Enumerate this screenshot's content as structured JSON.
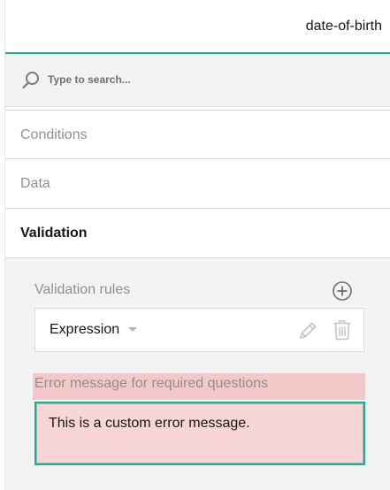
{
  "header": {
    "title": "date-of-birth"
  },
  "search": {
    "placeholder": "Type to search..."
  },
  "sections": [
    {
      "label": "Conditions",
      "active": false
    },
    {
      "label": "Data",
      "active": false
    },
    {
      "label": "Validation",
      "active": true
    }
  ],
  "validation": {
    "rules_label": "Validation rules",
    "rules": [
      {
        "type": "Expression"
      }
    ],
    "error_label": "Error message for required questions",
    "error_message": "This is a custom error message."
  },
  "colors": {
    "accent": "#19b394",
    "error_bg": "#f9d6d6",
    "error_label_bg": "#f3c8c8",
    "panel_bg": "#f3f3f3"
  },
  "icons": {
    "search": "search-icon",
    "add": "plus-circle-icon",
    "edit": "pencil-icon",
    "delete": "trash-icon",
    "dropdown": "caret-down-icon"
  }
}
